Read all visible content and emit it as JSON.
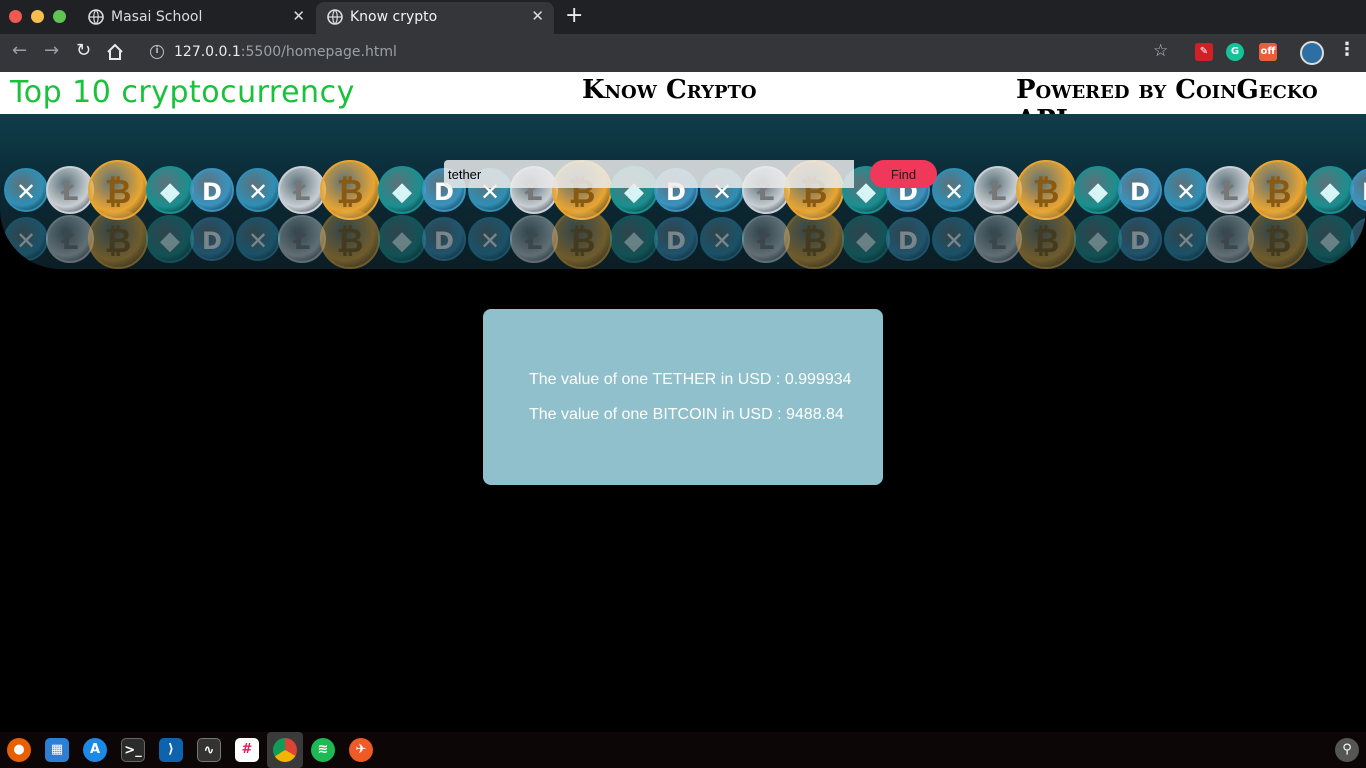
{
  "browser": {
    "tabs": [
      {
        "title": "Masai School",
        "active": false
      },
      {
        "title": "Know crypto",
        "active": true
      }
    ],
    "url_host": "127.0.0.1",
    "url_rest": ":5500/homepage.html"
  },
  "header": {
    "left_text": "Top 10 cryptocurrency",
    "center_text": "Know Crypto",
    "right_text": "Powered by CoinGecko API"
  },
  "search": {
    "value": "tether",
    "button_label": "Find"
  },
  "results": [
    {
      "text": "The value of one TETHER in USD : 0.999934"
    },
    {
      "text": "The value of one BITCOIN in USD : 9488.84"
    }
  ],
  "colors": {
    "header_left": "#19c23a",
    "find_button": "#f0395a",
    "result_card": "#8fc0cb",
    "page_bg": "#000000"
  },
  "dock": {
    "apps": [
      "firefox-icon",
      "files-icon",
      "appstore-icon",
      "terminal-icon",
      "vscode-icon",
      "monitor-icon",
      "slack-icon",
      "chrome-icon",
      "spotify-icon",
      "postman-icon"
    ]
  }
}
